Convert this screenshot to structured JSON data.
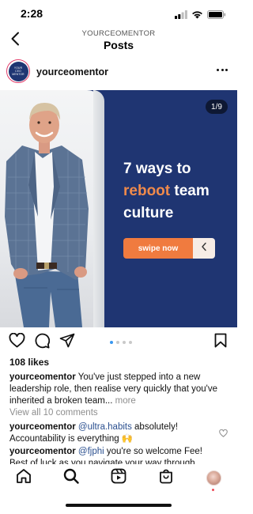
{
  "status_bar": {
    "time": "2:28",
    "icons": [
      "signal-icon",
      "wifi-icon",
      "battery-icon"
    ]
  },
  "header": {
    "account_label": "YOURCEOMENTOR",
    "title": "Posts",
    "back_icon": "chevron-left-icon"
  },
  "post": {
    "username": "yourceomentor",
    "avatar_text": [
      "YOUR",
      "CEO",
      "MENTOR"
    ],
    "more_icon": "more-horizontal-icon",
    "image": {
      "counter": "1/9",
      "headline_line1": "7 ways to",
      "headline_accent": "reboot",
      "headline_line2": " team",
      "headline_line3": "culture",
      "swipe_label": "swipe now",
      "accent_color": "#f07b3f",
      "background_color": "#1f3572"
    },
    "carousel": {
      "total": 4,
      "active": 0
    },
    "likes": "108 likes",
    "caption": {
      "username": "yourceomentor",
      "text": " You've just stepped into a new leadership role, then realise very quickly that you've inherited a broken team...",
      "more": " more"
    },
    "view_all_comments": "View all 10 comments",
    "comments": [
      {
        "username": "yourceomentor",
        "mention": " @ultra.habits",
        "text": " absolutely! Accountability is everything 🙌"
      },
      {
        "username": "yourceomentor",
        "mention": " @fjphi",
        "text": " you're so welcome Fee! Best of luck as you navigate your way through"
      }
    ]
  },
  "bottom_nav": {
    "items": [
      "home-icon",
      "search-icon",
      "reels-icon",
      "shop-icon",
      "profile-avatar"
    ]
  }
}
